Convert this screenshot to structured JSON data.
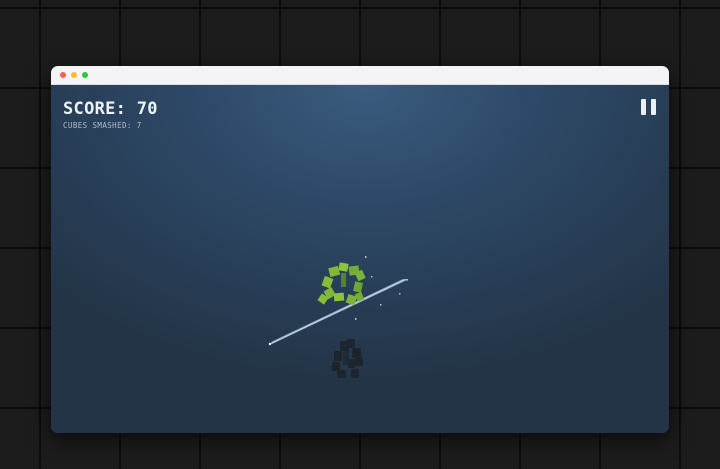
{
  "hud": {
    "score_text": "SCORE: 70",
    "smashed_text": "CUBES SMASHED: 7"
  },
  "game": {
    "score": 70,
    "cubes_smashed": 7,
    "paused": false
  },
  "colors": {
    "cube_green": "#7fb83a",
    "shadow": "#1d232b",
    "slash_trail": "#b9d3f0"
  },
  "icons": {
    "pause": "pause-icon"
  }
}
